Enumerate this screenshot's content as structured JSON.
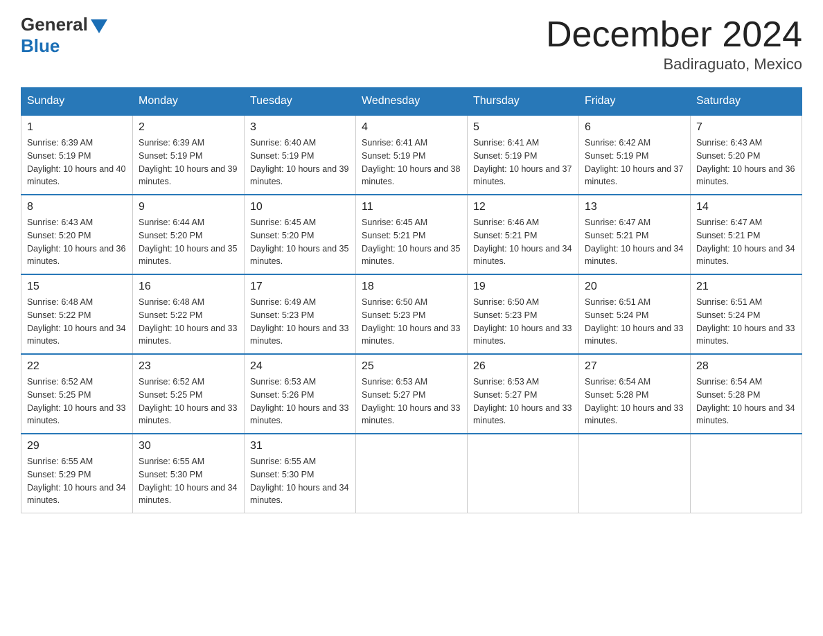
{
  "header": {
    "logo_general": "General",
    "logo_blue": "Blue",
    "month_title": "December 2024",
    "location": "Badiraguato, Mexico"
  },
  "days_of_week": [
    "Sunday",
    "Monday",
    "Tuesday",
    "Wednesday",
    "Thursday",
    "Friday",
    "Saturday"
  ],
  "weeks": [
    [
      {
        "day": "1",
        "sunrise": "6:39 AM",
        "sunset": "5:19 PM",
        "daylight": "10 hours and 40 minutes."
      },
      {
        "day": "2",
        "sunrise": "6:39 AM",
        "sunset": "5:19 PM",
        "daylight": "10 hours and 39 minutes."
      },
      {
        "day": "3",
        "sunrise": "6:40 AM",
        "sunset": "5:19 PM",
        "daylight": "10 hours and 39 minutes."
      },
      {
        "day": "4",
        "sunrise": "6:41 AM",
        "sunset": "5:19 PM",
        "daylight": "10 hours and 38 minutes."
      },
      {
        "day": "5",
        "sunrise": "6:41 AM",
        "sunset": "5:19 PM",
        "daylight": "10 hours and 37 minutes."
      },
      {
        "day": "6",
        "sunrise": "6:42 AM",
        "sunset": "5:19 PM",
        "daylight": "10 hours and 37 minutes."
      },
      {
        "day": "7",
        "sunrise": "6:43 AM",
        "sunset": "5:20 PM",
        "daylight": "10 hours and 36 minutes."
      }
    ],
    [
      {
        "day": "8",
        "sunrise": "6:43 AM",
        "sunset": "5:20 PM",
        "daylight": "10 hours and 36 minutes."
      },
      {
        "day": "9",
        "sunrise": "6:44 AM",
        "sunset": "5:20 PM",
        "daylight": "10 hours and 35 minutes."
      },
      {
        "day": "10",
        "sunrise": "6:45 AM",
        "sunset": "5:20 PM",
        "daylight": "10 hours and 35 minutes."
      },
      {
        "day": "11",
        "sunrise": "6:45 AM",
        "sunset": "5:21 PM",
        "daylight": "10 hours and 35 minutes."
      },
      {
        "day": "12",
        "sunrise": "6:46 AM",
        "sunset": "5:21 PM",
        "daylight": "10 hours and 34 minutes."
      },
      {
        "day": "13",
        "sunrise": "6:47 AM",
        "sunset": "5:21 PM",
        "daylight": "10 hours and 34 minutes."
      },
      {
        "day": "14",
        "sunrise": "6:47 AM",
        "sunset": "5:21 PM",
        "daylight": "10 hours and 34 minutes."
      }
    ],
    [
      {
        "day": "15",
        "sunrise": "6:48 AM",
        "sunset": "5:22 PM",
        "daylight": "10 hours and 34 minutes."
      },
      {
        "day": "16",
        "sunrise": "6:48 AM",
        "sunset": "5:22 PM",
        "daylight": "10 hours and 33 minutes."
      },
      {
        "day": "17",
        "sunrise": "6:49 AM",
        "sunset": "5:23 PM",
        "daylight": "10 hours and 33 minutes."
      },
      {
        "day": "18",
        "sunrise": "6:50 AM",
        "sunset": "5:23 PM",
        "daylight": "10 hours and 33 minutes."
      },
      {
        "day": "19",
        "sunrise": "6:50 AM",
        "sunset": "5:23 PM",
        "daylight": "10 hours and 33 minutes."
      },
      {
        "day": "20",
        "sunrise": "6:51 AM",
        "sunset": "5:24 PM",
        "daylight": "10 hours and 33 minutes."
      },
      {
        "day": "21",
        "sunrise": "6:51 AM",
        "sunset": "5:24 PM",
        "daylight": "10 hours and 33 minutes."
      }
    ],
    [
      {
        "day": "22",
        "sunrise": "6:52 AM",
        "sunset": "5:25 PM",
        "daylight": "10 hours and 33 minutes."
      },
      {
        "day": "23",
        "sunrise": "6:52 AM",
        "sunset": "5:25 PM",
        "daylight": "10 hours and 33 minutes."
      },
      {
        "day": "24",
        "sunrise": "6:53 AM",
        "sunset": "5:26 PM",
        "daylight": "10 hours and 33 minutes."
      },
      {
        "day": "25",
        "sunrise": "6:53 AM",
        "sunset": "5:27 PM",
        "daylight": "10 hours and 33 minutes."
      },
      {
        "day": "26",
        "sunrise": "6:53 AM",
        "sunset": "5:27 PM",
        "daylight": "10 hours and 33 minutes."
      },
      {
        "day": "27",
        "sunrise": "6:54 AM",
        "sunset": "5:28 PM",
        "daylight": "10 hours and 33 minutes."
      },
      {
        "day": "28",
        "sunrise": "6:54 AM",
        "sunset": "5:28 PM",
        "daylight": "10 hours and 34 minutes."
      }
    ],
    [
      {
        "day": "29",
        "sunrise": "6:55 AM",
        "sunset": "5:29 PM",
        "daylight": "10 hours and 34 minutes."
      },
      {
        "day": "30",
        "sunrise": "6:55 AM",
        "sunset": "5:30 PM",
        "daylight": "10 hours and 34 minutes."
      },
      {
        "day": "31",
        "sunrise": "6:55 AM",
        "sunset": "5:30 PM",
        "daylight": "10 hours and 34 minutes."
      },
      null,
      null,
      null,
      null
    ]
  ]
}
